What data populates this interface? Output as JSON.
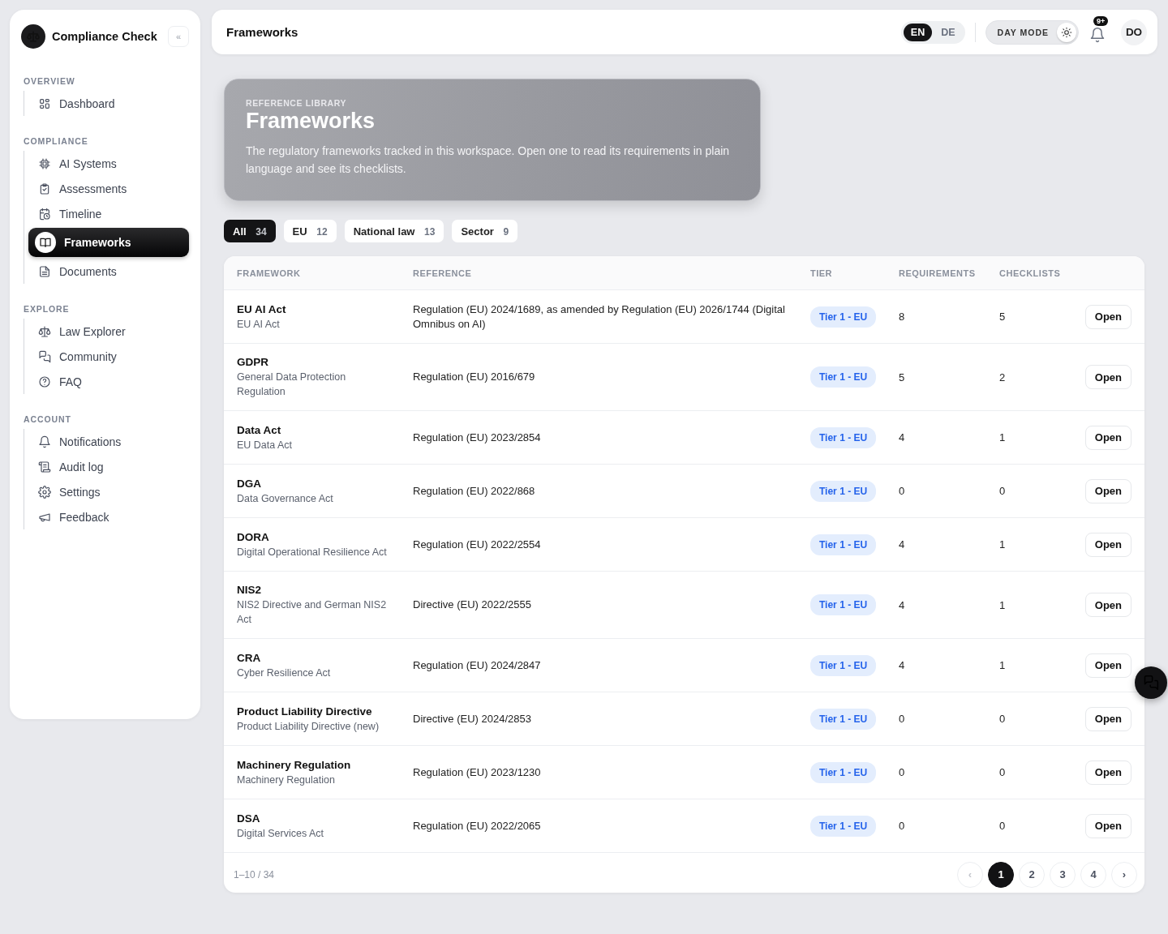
{
  "sidebar": {
    "brand": "Compliance Check",
    "collapse": "«",
    "sections": [
      {
        "title": "OVERVIEW",
        "items": [
          {
            "label": "Dashboard",
            "selected": false
          }
        ]
      },
      {
        "title": "COMPLIANCE",
        "items": [
          {
            "label": "AI Systems",
            "selected": false
          },
          {
            "label": "Assessments",
            "selected": false
          },
          {
            "label": "Timeline",
            "selected": false
          },
          {
            "label": "Frameworks",
            "selected": true
          },
          {
            "label": "Documents",
            "selected": false
          }
        ]
      },
      {
        "title": "EXPLORE",
        "items": [
          {
            "label": "Law Explorer",
            "selected": false
          },
          {
            "label": "Community",
            "selected": false
          },
          {
            "label": "FAQ",
            "selected": false
          }
        ]
      },
      {
        "title": "ACCOUNT",
        "items": [
          {
            "label": "Notifications",
            "selected": false
          },
          {
            "label": "Audit log",
            "selected": false
          },
          {
            "label": "Settings",
            "selected": false
          },
          {
            "label": "Feedback",
            "selected": false
          }
        ]
      }
    ]
  },
  "header": {
    "title": "Frameworks",
    "languages": [
      {
        "label": "EN",
        "selected": true
      },
      {
        "label": "DE",
        "selected": false
      }
    ],
    "theme": {
      "label": "DAY MODE",
      "on": true
    },
    "notification_badge": "9+",
    "avatar": "DO"
  },
  "hero": {
    "eyebrow": "REFERENCE LIBRARY",
    "title": "Frameworks",
    "description": "The regulatory frameworks tracked in this workspace. Open one to read its requirements in plain language and see its checklists."
  },
  "filters": [
    {
      "label": "All",
      "count": "34",
      "selected": true
    },
    {
      "label": "EU",
      "count": "12",
      "selected": false
    },
    {
      "label": "National law",
      "count": "13",
      "selected": false
    },
    {
      "label": "Sector",
      "count": "9",
      "selected": false
    }
  ],
  "table": {
    "columns": [
      "FRAMEWORK",
      "REFERENCE",
      "TIER",
      "REQUIREMENTS",
      "CHECKLISTS"
    ],
    "rows": [
      {
        "name": "EU AI Act",
        "subtitle": "EU AI Act",
        "reference": "Regulation (EU) 2024/1689, as amended by Regulation (EU) 2026/1744 (Digital Omnibus on AI)",
        "tier": "Tier 1 - EU",
        "requirements": "8",
        "checklists": "5",
        "action": "Open"
      },
      {
        "name": "GDPR",
        "subtitle": "General Data Protection Regulation",
        "reference": "Regulation (EU) 2016/679",
        "tier": "Tier 1 - EU",
        "requirements": "5",
        "checklists": "2",
        "action": "Open"
      },
      {
        "name": "Data Act",
        "subtitle": "EU Data Act",
        "reference": "Regulation (EU) 2023/2854",
        "tier": "Tier 1 - EU",
        "requirements": "4",
        "checklists": "1",
        "action": "Open"
      },
      {
        "name": "DGA",
        "subtitle": "Data Governance Act",
        "reference": "Regulation (EU) 2022/868",
        "tier": "Tier 1 - EU",
        "requirements": "0",
        "checklists": "0",
        "action": "Open"
      },
      {
        "name": "DORA",
        "subtitle": "Digital Operational Resilience Act",
        "reference": "Regulation (EU) 2022/2554",
        "tier": "Tier 1 - EU",
        "requirements": "4",
        "checklists": "1",
        "action": "Open"
      },
      {
        "name": "NIS2",
        "subtitle": "NIS2 Directive and German NIS2 Act",
        "reference": "Directive (EU) 2022/2555",
        "tier": "Tier 1 - EU",
        "requirements": "4",
        "checklists": "1",
        "action": "Open"
      },
      {
        "name": "CRA",
        "subtitle": "Cyber Resilience Act",
        "reference": "Regulation (EU) 2024/2847",
        "tier": "Tier 1 - EU",
        "requirements": "4",
        "checklists": "1",
        "action": "Open"
      },
      {
        "name": "Product Liability Directive",
        "subtitle": "Product Liability Directive (new)",
        "reference": "Directive (EU) 2024/2853",
        "tier": "Tier 1 - EU",
        "requirements": "0",
        "checklists": "0",
        "action": "Open"
      },
      {
        "name": "Machinery Regulation",
        "subtitle": "Machinery Regulation",
        "reference": "Regulation (EU) 2023/1230",
        "tier": "Tier 1 - EU",
        "requirements": "0",
        "checklists": "0",
        "action": "Open"
      },
      {
        "name": "DSA",
        "subtitle": "Digital Services Act",
        "reference": "Regulation (EU) 2022/2065",
        "tier": "Tier 1 - EU",
        "requirements": "0",
        "checklists": "0",
        "action": "Open"
      }
    ]
  },
  "pagination": {
    "summary": "1–10 / 34",
    "prev": "‹",
    "next": "›",
    "pages": [
      {
        "label": "1",
        "selected": true
      },
      {
        "label": "2",
        "selected": false
      },
      {
        "label": "3",
        "selected": false
      },
      {
        "label": "4",
        "selected": false
      }
    ]
  }
}
